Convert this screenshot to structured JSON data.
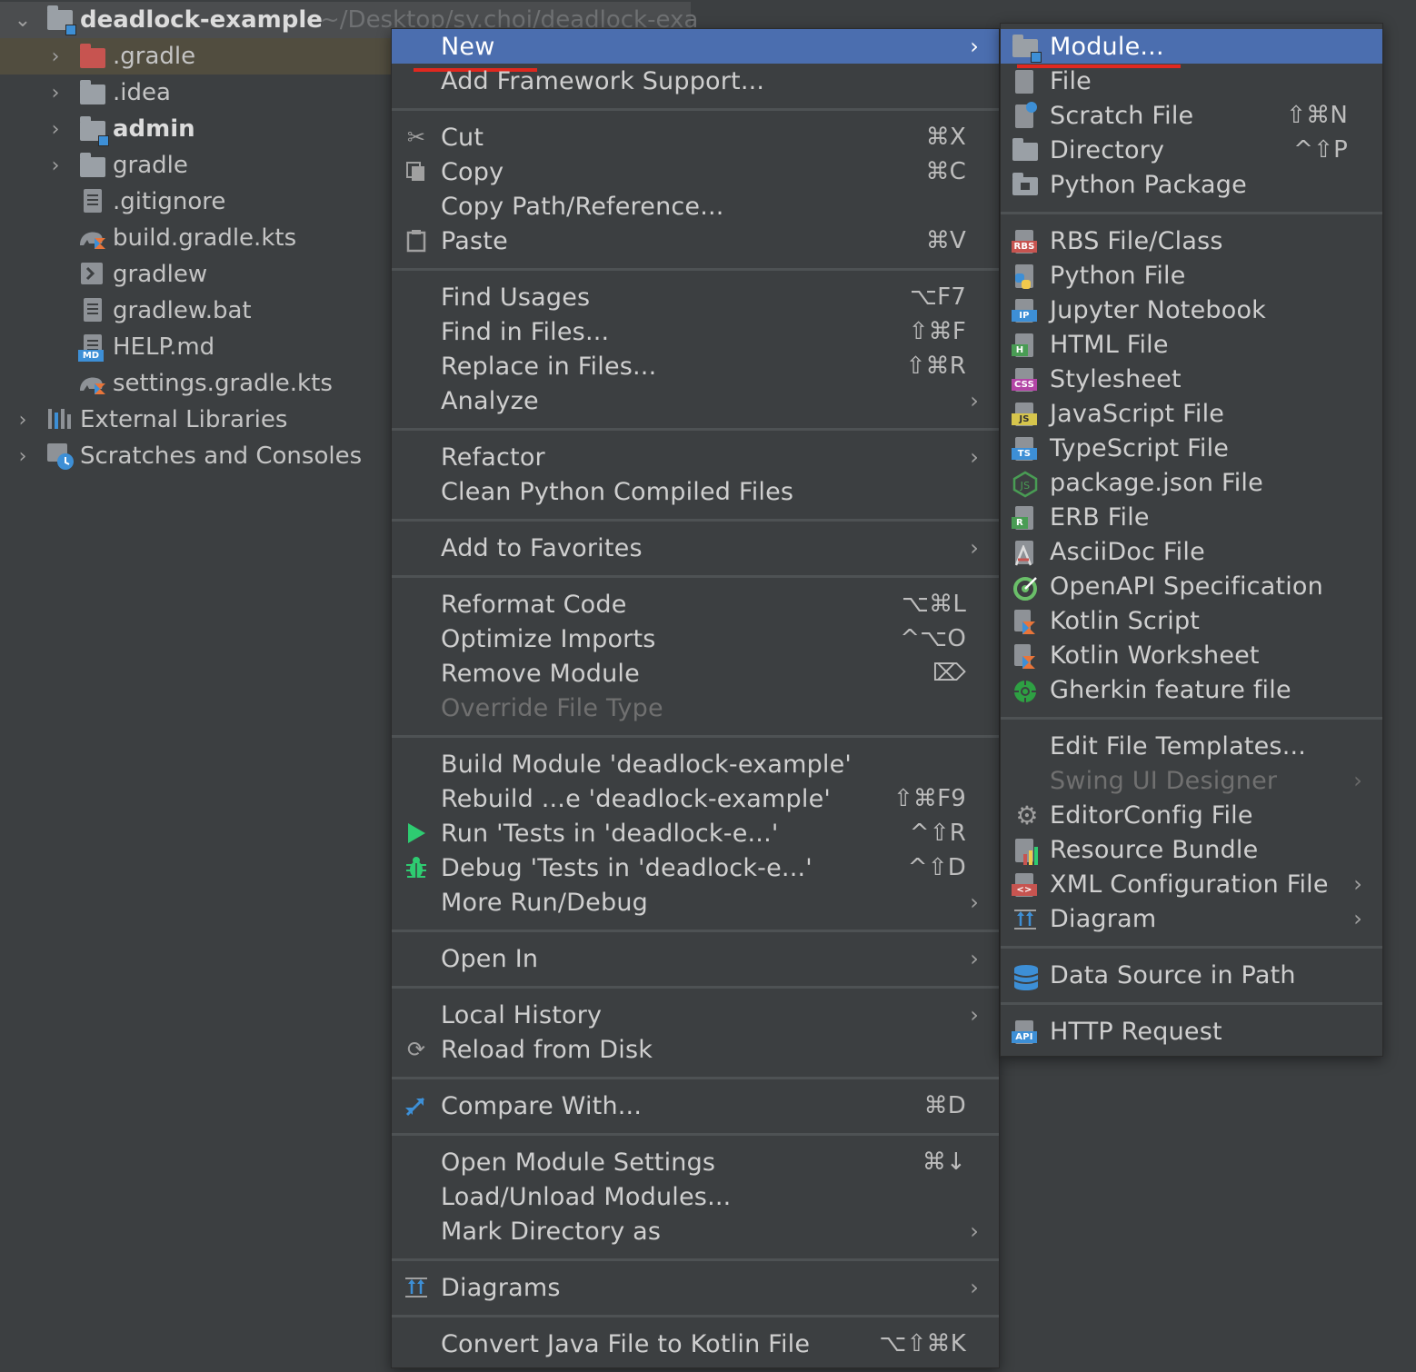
{
  "tree": {
    "root": {
      "label": "deadlock-example",
      "path": "~/Desktop/sy.choi/deadlock-exa"
    },
    "items": [
      {
        "label": ".gradle"
      },
      {
        "label": ".idea"
      },
      {
        "label": "admin"
      },
      {
        "label": "gradle"
      },
      {
        "label": ".gitignore"
      },
      {
        "label": "build.gradle.kts"
      },
      {
        "label": "gradlew"
      },
      {
        "label": "gradlew.bat"
      },
      {
        "label": "HELP.md"
      },
      {
        "label": "settings.gradle.kts"
      },
      {
        "label": "External Libraries"
      },
      {
        "label": "Scratches and Consoles"
      }
    ],
    "icon_labels": {
      "md": "MD"
    }
  },
  "main_menu": {
    "items": [
      {
        "label": "New",
        "shortcut": ""
      },
      {
        "label": "Add Framework Support...",
        "shortcut": ""
      },
      {
        "label": "Cut",
        "shortcut": "⌘X"
      },
      {
        "label": "Copy",
        "shortcut": "⌘C"
      },
      {
        "label": "Copy Path/Reference...",
        "shortcut": ""
      },
      {
        "label": "Paste",
        "shortcut": "⌘V"
      },
      {
        "label": "Find Usages",
        "shortcut": "⌥F7"
      },
      {
        "label": "Find in Files...",
        "shortcut": "⇧⌘F"
      },
      {
        "label": "Replace in Files...",
        "shortcut": "⇧⌘R"
      },
      {
        "label": "Analyze",
        "shortcut": ""
      },
      {
        "label": "Refactor",
        "shortcut": ""
      },
      {
        "label": "Clean Python Compiled Files",
        "shortcut": ""
      },
      {
        "label": "Add to Favorites",
        "shortcut": ""
      },
      {
        "label": "Reformat Code",
        "shortcut": "⌥⌘L"
      },
      {
        "label": "Optimize Imports",
        "shortcut": "^⌥O"
      },
      {
        "label": "Remove Module",
        "shortcut": "⌦"
      },
      {
        "label": "Override File Type",
        "shortcut": ""
      },
      {
        "label": "Build Module 'deadlock-example'",
        "shortcut": ""
      },
      {
        "label": "Rebuild ...e 'deadlock-example'",
        "shortcut": "⇧⌘F9"
      },
      {
        "label": "Run 'Tests in 'deadlock-e...'",
        "shortcut": "^⇧R"
      },
      {
        "label": "Debug 'Tests in 'deadlock-e...'",
        "shortcut": "^⇧D"
      },
      {
        "label": "More Run/Debug",
        "shortcut": ""
      },
      {
        "label": "Open In",
        "shortcut": ""
      },
      {
        "label": "Local History",
        "shortcut": ""
      },
      {
        "label": "Reload from Disk",
        "shortcut": ""
      },
      {
        "label": "Compare With...",
        "shortcut": "⌘D"
      },
      {
        "label": "Open Module Settings",
        "shortcut": "⌘↓"
      },
      {
        "label": "Load/Unload Modules...",
        "shortcut": ""
      },
      {
        "label": "Mark Directory as",
        "shortcut": ""
      },
      {
        "label": "Diagrams",
        "shortcut": ""
      },
      {
        "label": "Convert Java File to Kotlin File",
        "shortcut": "⌥⇧⌘K"
      }
    ]
  },
  "sub_menu": {
    "items": [
      {
        "label": "Module...",
        "shortcut": ""
      },
      {
        "label": "File",
        "shortcut": ""
      },
      {
        "label": "Scratch File",
        "shortcut": "⇧⌘N"
      },
      {
        "label": "Directory",
        "shortcut": "^⇧P"
      },
      {
        "label": "Python Package",
        "shortcut": ""
      },
      {
        "label": "RBS File/Class",
        "shortcut": ""
      },
      {
        "label": "Python File",
        "shortcut": ""
      },
      {
        "label": "Jupyter Notebook",
        "shortcut": ""
      },
      {
        "label": "HTML File",
        "shortcut": ""
      },
      {
        "label": "Stylesheet",
        "shortcut": ""
      },
      {
        "label": "JavaScript File",
        "shortcut": ""
      },
      {
        "label": "TypeScript File",
        "shortcut": ""
      },
      {
        "label": "package.json File",
        "shortcut": ""
      },
      {
        "label": "ERB File",
        "shortcut": ""
      },
      {
        "label": "AsciiDoc File",
        "shortcut": ""
      },
      {
        "label": "OpenAPI Specification",
        "shortcut": ""
      },
      {
        "label": "Kotlin Script",
        "shortcut": ""
      },
      {
        "label": "Kotlin Worksheet",
        "shortcut": ""
      },
      {
        "label": "Gherkin feature file",
        "shortcut": ""
      },
      {
        "label": "Edit File Templates...",
        "shortcut": ""
      },
      {
        "label": "Swing UI Designer",
        "shortcut": ""
      },
      {
        "label": "EditorConfig File",
        "shortcut": ""
      },
      {
        "label": "Resource Bundle",
        "shortcut": ""
      },
      {
        "label": "XML Configuration File",
        "shortcut": ""
      },
      {
        "label": "Diagram",
        "shortcut": ""
      },
      {
        "label": "Data Source in Path",
        "shortcut": ""
      },
      {
        "label": "HTTP Request",
        "shortcut": ""
      }
    ],
    "icon_tags": {
      "rbs": "RBS",
      "ip": "IP",
      "h": "H",
      "css": "CSS",
      "js": "JS",
      "ts": "TS",
      "r": "R",
      "api": "API",
      "xml": "<>"
    }
  },
  "colors": {
    "highlight": "#4b6eaf",
    "background": "#3c3f41",
    "annotation": "#e0281f",
    "run_green": "#2ecc71",
    "module_blue": "#3d8fd6"
  }
}
